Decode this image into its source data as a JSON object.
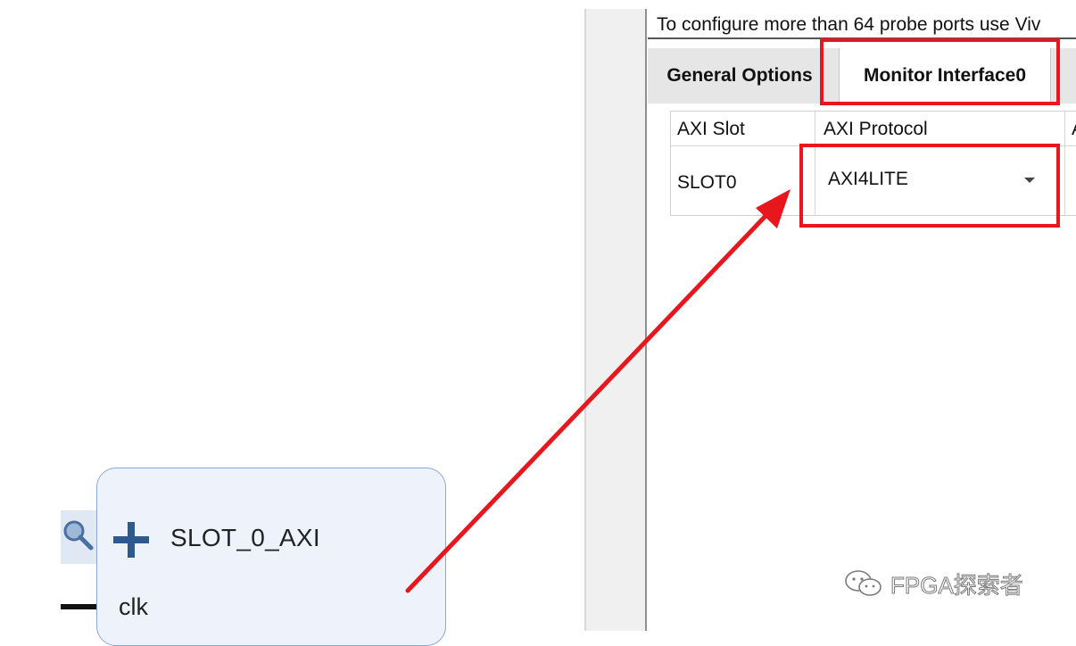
{
  "canvas": {
    "block": {
      "title": "SLOT_0_AXI",
      "port_label": "clk",
      "icons": [
        "zoom-icon",
        "plus-icon"
      ]
    }
  },
  "panel": {
    "info_text": "To configure more than 64 probe ports use Viv",
    "tabs": [
      {
        "label": "General Options",
        "selected": false
      },
      {
        "label": "Monitor Interface0",
        "selected": true
      }
    ],
    "table": {
      "headers": [
        "AXI Slot",
        "AXI Protocol",
        "A"
      ],
      "rows": [
        {
          "slot": "SLOT0",
          "protocol": "AXI4LITE"
        }
      ]
    }
  },
  "annotations": {
    "highlight_color": "#e8161d"
  },
  "watermark": {
    "text": "FPGA探索者",
    "icon": "wechat-icon"
  }
}
